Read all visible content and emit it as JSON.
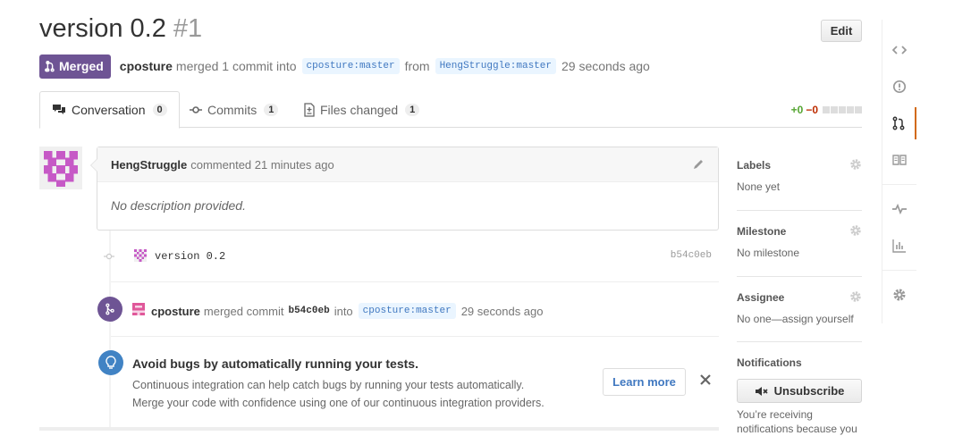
{
  "pr": {
    "title": "version 0.2",
    "number": "#1",
    "edit_label": "Edit",
    "state_label": "Merged",
    "author": "cposture",
    "action_text": "merged 1 commit into",
    "base_branch": "cposture:master",
    "from_text": "from",
    "head_branch": "HengStruggle:master",
    "time_ago": "29 seconds ago"
  },
  "tabs": [
    {
      "label": "Conversation",
      "count": "0"
    },
    {
      "label": "Commits",
      "count": "1"
    },
    {
      "label": "Files changed",
      "count": "1"
    }
  ],
  "diffstat": {
    "additions": "+0",
    "deletions": "−0"
  },
  "comment": {
    "author": "HengStruggle",
    "action": "commented",
    "time_ago": "21 minutes ago",
    "body": "No description provided."
  },
  "commit": {
    "message": "version 0.2",
    "sha": "b54c0eb"
  },
  "merge_event": {
    "author": "cposture",
    "action": "merged commit",
    "sha": "b54c0eb",
    "into": "into",
    "branch": "cposture:master",
    "time_ago": "29 seconds ago"
  },
  "ci_tip": {
    "title": "Avoid bugs by automatically running your tests.",
    "line1": "Continuous integration can help catch bugs by running your tests automatically.",
    "line2": "Merge your code with confidence using one of our continuous integration providers.",
    "learn_more": "Learn more"
  },
  "sidebar": {
    "labels_heading": "Labels",
    "labels_value": "None yet",
    "milestone_heading": "Milestone",
    "milestone_value": "No milestone",
    "assignee_heading": "Assignee",
    "assignee_value": "No one—assign yourself",
    "notifications_heading": "Notifications",
    "unsubscribe_label": "Unsubscribe",
    "notifications_note": "You’re receiving notifications because you"
  },
  "colors": {
    "merged": "#6e5494",
    "link": "#4078c0",
    "rail_active": "#d26911",
    "tip_icon": "#4183c4"
  }
}
